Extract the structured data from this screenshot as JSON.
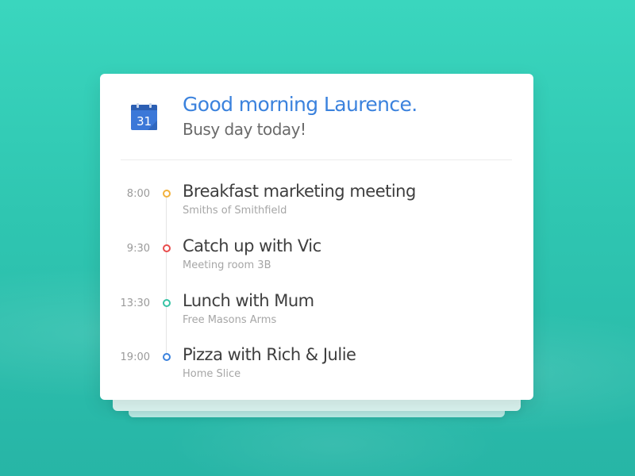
{
  "header": {
    "greeting": "Good morning Laurence.",
    "subtitle": "Busy day today!",
    "calendar_icon_day": "31",
    "calendar_icon_name": "calendar-icon",
    "calendar_icon_color": "#3b82dd"
  },
  "events": [
    {
      "time": "8:00",
      "title": "Breakfast marketing meeting",
      "location": "Smiths of Smithfield",
      "dot_color": "#f2b13c"
    },
    {
      "time": "9:30",
      "title": "Catch up with Vic",
      "location": "Meeting room 3B",
      "dot_color": "#e84c4c"
    },
    {
      "time": "13:30",
      "title": "Lunch with Mum",
      "location": "Free Masons Arms",
      "dot_color": "#36c3a5"
    },
    {
      "time": "19:00",
      "title": "Pizza with Rich & Julie",
      "location": "Home Slice",
      "dot_color": "#3b82dd"
    }
  ],
  "colors": {
    "background": "#2fc6b1",
    "accent": "#3b82dd"
  }
}
